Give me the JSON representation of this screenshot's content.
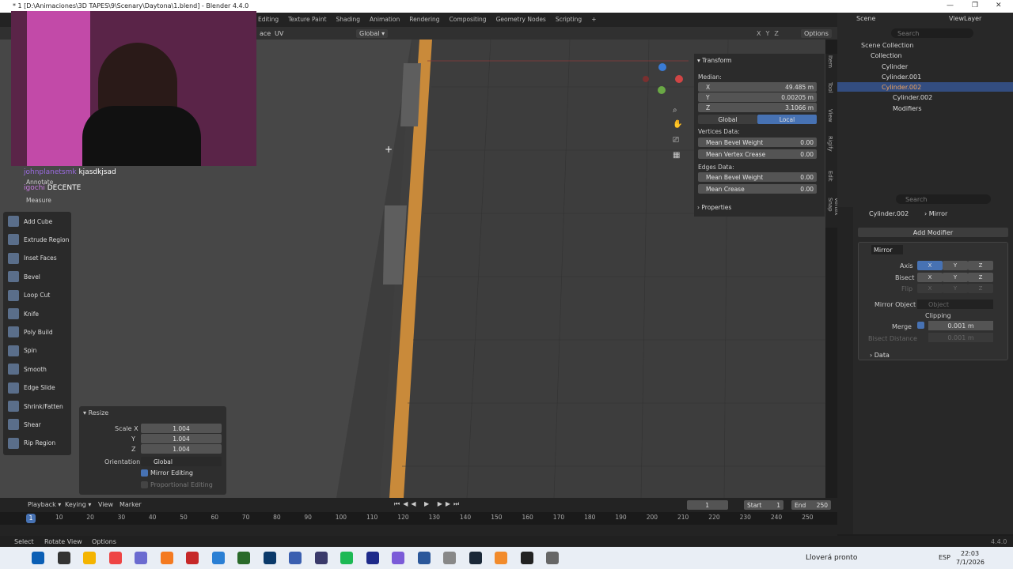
{
  "window": {
    "title": "* 1 [D:\\Animaciones\\3D TAPES\\9\\Scenary\\Daytona\\1.blend] - Blender 4.4.0"
  },
  "workspaces": [
    "Editing",
    "Texture Paint",
    "Shading",
    "Animation",
    "Rendering",
    "Compositing",
    "Geometry Nodes",
    "Scripting",
    "+"
  ],
  "scene": {
    "label": "Scene",
    "view_layer": "ViewLayer"
  },
  "header": {
    "face_label": "ace",
    "uv": "UV",
    "orientation": "Global",
    "options": "Options",
    "axes": [
      "X",
      "Y",
      "Z"
    ]
  },
  "chat": [
    {
      "user": "johnplanetsmk",
      "msg": "kjasdkjsad"
    },
    {
      "user": "igochi",
      "msg": "DECENTE"
    }
  ],
  "tools": [
    "Annotate",
    "Measure",
    "Add Cube",
    "Extrude Region",
    "Inset Faces",
    "Bevel",
    "Loop Cut",
    "Knife",
    "Poly Build",
    "Spin",
    "Smooth",
    "Edge Slide",
    "Shrink/Fatten",
    "Shear",
    "Rip Region"
  ],
  "transform": {
    "title": "Transform",
    "median": "Median:",
    "x_label": "X",
    "x": "49.485 m",
    "y_label": "Y",
    "y": "0.00205 m",
    "z_label": "Z",
    "z": "3.1066 m",
    "global": "Global",
    "local": "Local",
    "vertices_data": "Vertices Data:",
    "mean_bevel_weight": "Mean Bevel Weight",
    "mbw_val": "0.00",
    "mean_vertex_crease": "Mean Vertex Crease",
    "mvc_val": "0.00",
    "edges_data": "Edges Data:",
    "edge_mbw": "Mean Bevel Weight",
    "edge_mbw_val": "0.00",
    "mean_crease": "Mean Crease",
    "mc_val": "0.00",
    "properties": "Properties"
  },
  "side_tabs": [
    "Item",
    "Tool",
    "View",
    "Rigify",
    "Edit",
    "PSX Vertex Snap"
  ],
  "outliner": {
    "search_placeholder": "Search",
    "scene_collection": "Scene Collection",
    "collection": "Collection",
    "items": [
      "Cylinder",
      "Cylinder.001",
      "Cylinder.002"
    ],
    "mesh": "Cylinder.002",
    "modifiers": "Modifiers"
  },
  "properties": {
    "search_placeholder": "Search",
    "object": "Cylinder.002",
    "modifier": "Mirror",
    "add_modifier": "Add Modifier",
    "mod_name": "Mirror",
    "axis": "Axis",
    "bisect": "Bisect",
    "flip": "Flip",
    "xyz": [
      "X",
      "Y",
      "Z"
    ],
    "mirror_object": "Mirror Object",
    "object_placeholder": "Object",
    "clipping": "Clipping",
    "merge": "Merge",
    "merge_val": "0.001 m",
    "bisect_distance": "Bisect Distance",
    "bisect_val": "0.001 m",
    "data": "Data"
  },
  "resize_panel": {
    "title": "Resize",
    "scale_x": "Scale X",
    "sx": "1.004",
    "y": "Y",
    "sy": "1.004",
    "z": "Z",
    "sz": "1.004",
    "orientation": "Orientation",
    "orient_val": "Global",
    "mirror_editing": "Mirror Editing",
    "prop_editing": "Proportional Editing"
  },
  "timeline": {
    "playback": "Playback",
    "keying": "Keying",
    "view": "View",
    "marker": "Marker",
    "current_frame": "1",
    "start_label": "Start",
    "start": "1",
    "end_label": "End",
    "end": "250",
    "frame_marker": "1",
    "ticks": [
      "10",
      "20",
      "30",
      "40",
      "50",
      "60",
      "70",
      "80",
      "90",
      "100",
      "110",
      "120",
      "130",
      "140",
      "150",
      "160",
      "170",
      "180",
      "190",
      "200",
      "210",
      "220",
      "230",
      "240",
      "250"
    ]
  },
  "status": {
    "select": "Select",
    "rotate": "Rotate View",
    "options": "Options",
    "version": "4.4.0"
  },
  "taskbar": {
    "weather": "Lloverá pronto",
    "lang": "ESP",
    "time": "22:03",
    "date": "7/1/2026"
  }
}
